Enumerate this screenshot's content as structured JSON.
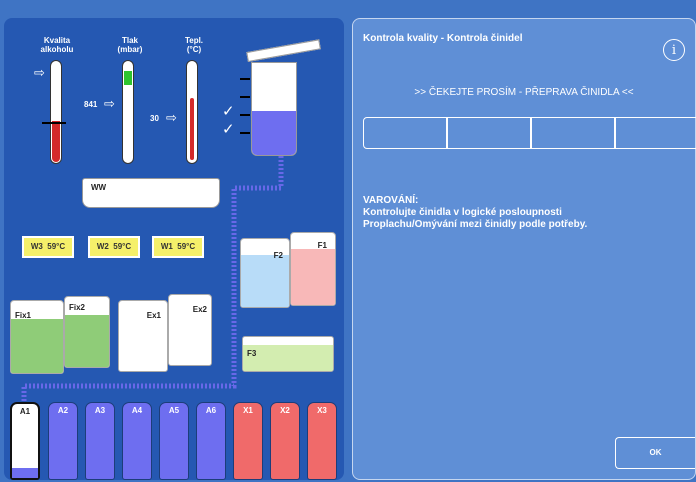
{
  "gauges": {
    "alcohol_label": "Kvalita\nalkoholu",
    "pressure_label": "Tlak\n(mbar)",
    "temp_label": "Tepl.\n(°C)",
    "pressure_value": "841",
    "temp_value": "30"
  },
  "tank": {
    "checks": [
      "✓",
      "✓"
    ]
  },
  "waste": {
    "label": "WW"
  },
  "wax_baths": [
    {
      "name": "W3",
      "temp": "59°C"
    },
    {
      "name": "W2",
      "temp": "59°C"
    },
    {
      "name": "W1",
      "temp": "59°C"
    }
  ],
  "containers": {
    "fix1": "Fix1",
    "fix2": "Fix2",
    "ex1": "Ex1",
    "ex2": "Ex2",
    "f1": "F1",
    "f2": "F2",
    "f3": "F3"
  },
  "bottles": [
    {
      "label": "A1",
      "color": "#ffffff"
    },
    {
      "label": "A2",
      "color": "#6e6ef0"
    },
    {
      "label": "A3",
      "color": "#6e6ef0"
    },
    {
      "label": "A4",
      "color": "#6e6ef0"
    },
    {
      "label": "A5",
      "color": "#6e6ef0"
    },
    {
      "label": "A6",
      "color": "#6e6ef0"
    },
    {
      "label": "X1",
      "color": "#f06a6a"
    },
    {
      "label": "X2",
      "color": "#f06a6a"
    },
    {
      "label": "X3",
      "color": "#f06a6a"
    }
  ],
  "dialog": {
    "title": "Kontrola kvality - Kontrola činidel",
    "info_icon": "i",
    "status": ">> ČEKEJTE PROSÍM - PŘEPRAVA ČINIDLA <<",
    "warning_title": "VAROVÁNÍ:",
    "warning_line1": "Kontrolujte činidla v logické posloupnosti",
    "warning_line2": "Proplachu/Omývání mezi činidly podle potřeby.",
    "ok_label": "OK"
  },
  "colors": {
    "background": "#3f74c4",
    "left_panel": "#2558b2",
    "right_panel": "#5f8fd6",
    "wax": "#f5f06a",
    "reagent_blue": "#6e6ef0",
    "reagent_red": "#f06a6a",
    "fix_green": "#8fcc78"
  }
}
